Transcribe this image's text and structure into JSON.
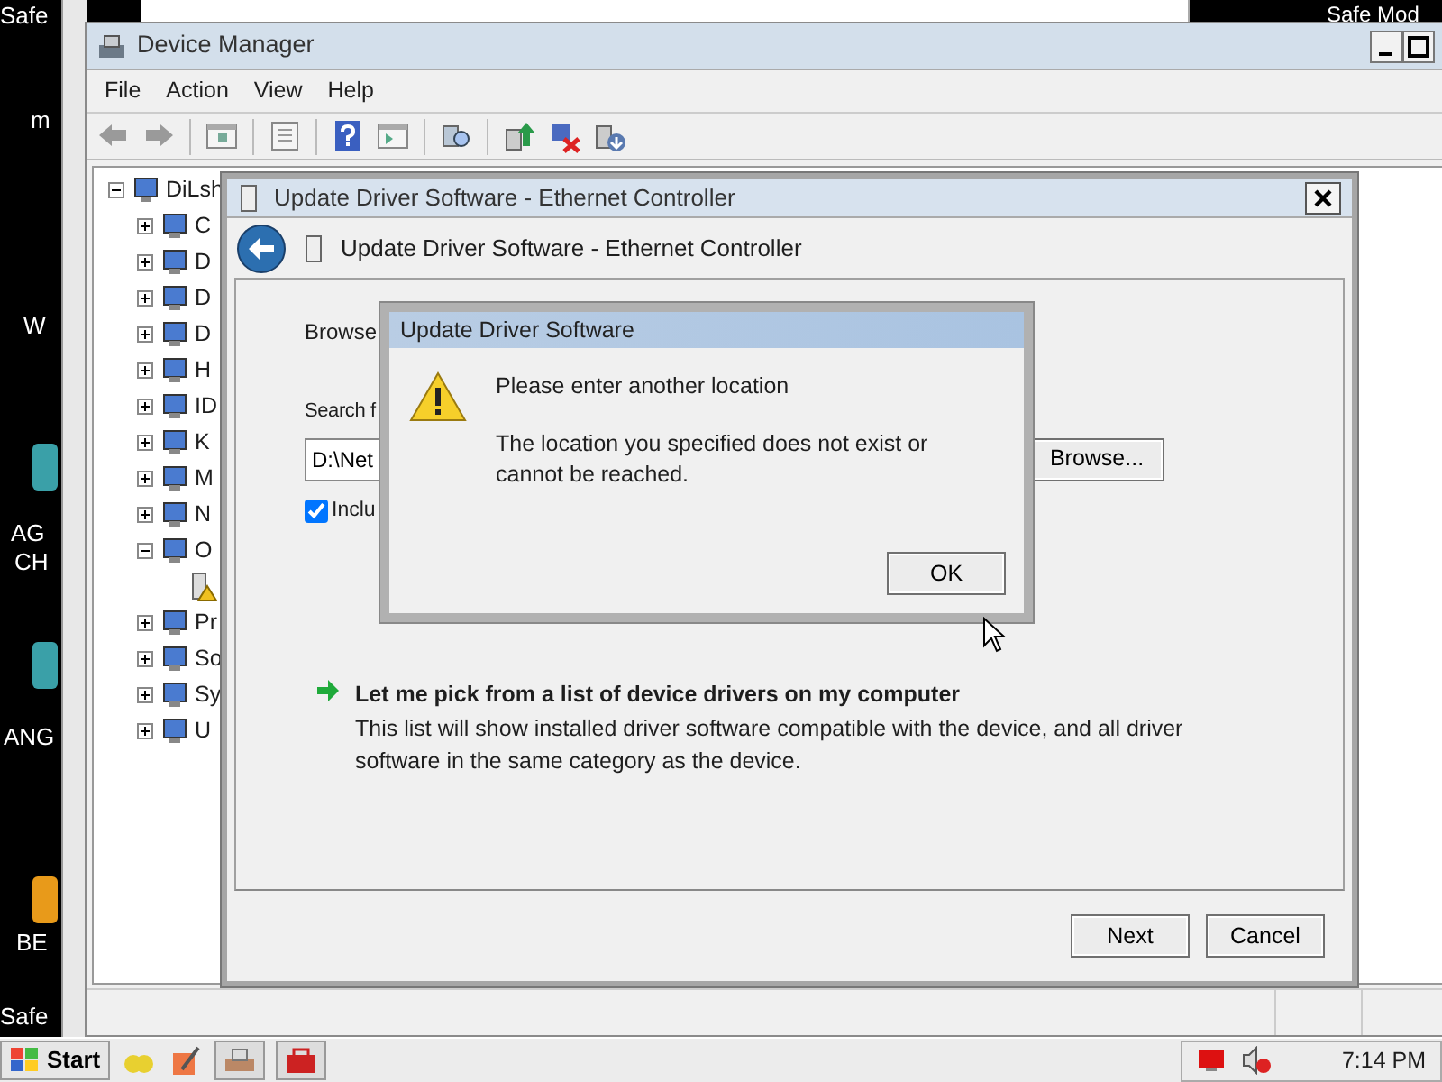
{
  "desktop": {
    "labels": [
      "Safe",
      "m",
      "W",
      "AG",
      "CH",
      "ANG",
      "BE",
      "Safe",
      "Safe Mod"
    ]
  },
  "device_manager": {
    "title": "Device Manager",
    "menu": [
      "File",
      "Action",
      "View",
      "Help"
    ],
    "tree": [
      {
        "label": "DiLsh",
        "expanded": true,
        "children": [
          {
            "label": "C",
            "expanded": false
          },
          {
            "label": "D",
            "expanded": false
          },
          {
            "label": "D",
            "expanded": false
          },
          {
            "label": "D",
            "expanded": false
          },
          {
            "label": "H",
            "expanded": false
          },
          {
            "label": "ID",
            "expanded": false
          },
          {
            "label": "K",
            "expanded": false
          },
          {
            "label": "M",
            "expanded": false
          },
          {
            "label": "N",
            "expanded": false
          },
          {
            "label": "O",
            "expanded": true,
            "children": [
              {
                "warning": true
              }
            ]
          },
          {
            "label": "Pr",
            "expanded": false
          },
          {
            "label": "So",
            "expanded": false
          },
          {
            "label": "Sy",
            "expanded": false
          },
          {
            "label": "U",
            "expanded": false
          }
        ]
      }
    ]
  },
  "wizard": {
    "title": "Update Driver Software - Ethernet Controller",
    "heading": "Update Driver Software - Ethernet Controller",
    "browse_label": "Browse",
    "search_label": "Search f",
    "path_value": "D:\\Net",
    "browse_button": "Browse...",
    "include_subfolders": {
      "label": "Inclu",
      "checked": true
    },
    "option": {
      "title": "Let me pick from a list of device drivers on my computer",
      "description": "This list will show installed driver software compatible with the device, and all driver software in the same category as the device."
    },
    "buttons": [
      {
        "label": "Next"
      },
      {
        "label": "Cancel"
      }
    ]
  },
  "message": {
    "title": "Update Driver Software",
    "heading": "Please enter another location",
    "text": "The location you specified does not exist or cannot be reached.",
    "button": "OK"
  },
  "taskbar": {
    "start": "Start",
    "time": "7:14 PM"
  }
}
